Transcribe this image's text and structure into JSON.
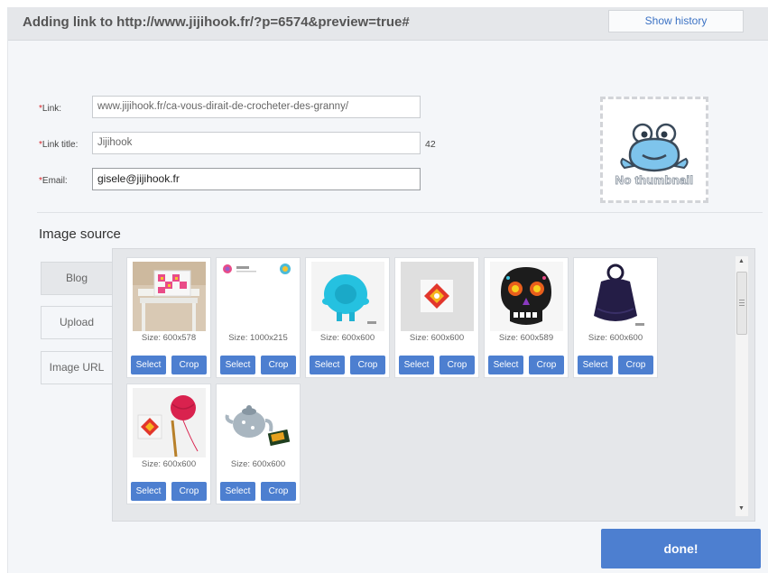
{
  "header": {
    "title": "Adding link to http://www.jijihook.fr/?p=6574&preview=true#",
    "history_label": "Show history"
  },
  "form": {
    "required_mark": "*",
    "link_label": "Link:",
    "link_value": "www.jijihook.fr/ca-vous-dirait-de-crocheter-des-granny/",
    "title_label": "Link title:",
    "title_value": "Jijihook",
    "title_count": "42",
    "email_label": "Email:",
    "email_value": "gisele@jijihook.fr"
  },
  "thumbnail": {
    "placeholder_text": "No thumbnail",
    "icon": "frog-icon"
  },
  "image_source": {
    "title": "Image source",
    "tabs": [
      {
        "label": "Blog"
      },
      {
        "label": "Upload"
      },
      {
        "label": "Image URL"
      }
    ],
    "select_label": "Select",
    "crop_label": "Crop",
    "images": [
      {
        "size": "Size: 600x578",
        "subject": "pillow-on-chair"
      },
      {
        "size": "Size: 1000x215",
        "subject": "banner"
      },
      {
        "size": "Size: 600x600",
        "subject": "blue-crochet-toy"
      },
      {
        "size": "Size: 600x600",
        "subject": "granny-square"
      },
      {
        "size": "Size: 600x589",
        "subject": "crochet-skull"
      },
      {
        "size": "Size: 600x600",
        "subject": "dark-bag"
      },
      {
        "size": "Size: 600x600",
        "subject": "yarn-and-hook"
      },
      {
        "size": "Size: 600x600",
        "subject": "teapot-and-book"
      }
    ]
  },
  "footer": {
    "done_label": "done!"
  },
  "colors": {
    "accent": "#4d7fd0",
    "required": "#d9262b",
    "link": "#3b72c4"
  }
}
